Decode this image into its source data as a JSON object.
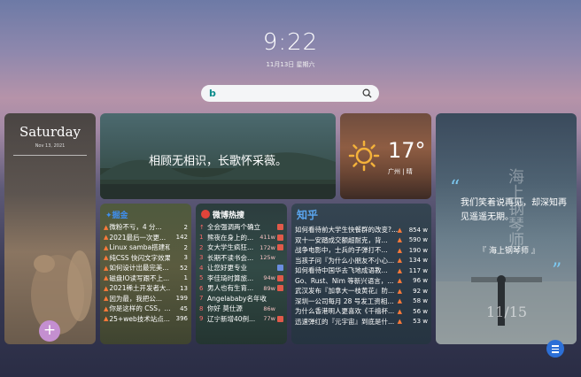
{
  "clock": {
    "time": "9:22",
    "date": "11月13日 星期六"
  },
  "search": {
    "engine_icon": "bing-icon",
    "placeholder": ""
  },
  "saturday_card": {
    "day": "Saturday",
    "date": "Nov 13, 2021"
  },
  "quote_card": {
    "text": "相顾无相识，长歌怀采薇。"
  },
  "weather_card": {
    "temperature": "17°",
    "city": "广州 | 晴",
    "icon": "sun-icon"
  },
  "movie_card": {
    "quote": "我们笑着说再见，却深知再见遥遥无期。",
    "source": "『 海上钢琴师 』",
    "poster_title": "海上钢琴师",
    "poster_date": "11/15"
  },
  "juejin": {
    "title": "掘金",
    "items": [
      {
        "text": "微粉不亏，4 分...",
        "count": "2"
      },
      {
        "text": "2021最后一次更...",
        "count": "142"
      },
      {
        "text": "Linux samba搭建和...",
        "count": "2"
      },
      {
        "text": "纯CSS 快闪文字效果",
        "count": "3"
      },
      {
        "text": "如何设计出最完美...",
        "count": "52"
      },
      {
        "text": "磁盘IO读写跟不上...",
        "count": "1"
      },
      {
        "text": "2021稀土开发者大...",
        "count": "13"
      },
      {
        "text": "因为最，我把公...",
        "count": "199"
      },
      {
        "text": "你是这样的 CSS，...",
        "count": "45"
      },
      {
        "text": "25+web技术站点...",
        "count": "396"
      }
    ]
  },
  "weibo": {
    "title": "微博热搜",
    "items": [
      {
        "rank": "",
        "text": "全会强调两个确立",
        "hot": "",
        "badge": "#e05a4a"
      },
      {
        "rank": "1",
        "text": "熊夜在身上的...",
        "hot": "411w",
        "badge": "#e05a4a"
      },
      {
        "rank": "2",
        "text": "女大学生疯狂...",
        "hot": "172w",
        "badge": "#e05a4a"
      },
      {
        "rank": "3",
        "text": "长期不读书会...",
        "hot": "125w",
        "badge": ""
      },
      {
        "rank": "4",
        "text": "让您好更专业",
        "hot": "",
        "badge": "#6a8de0"
      },
      {
        "rank": "5",
        "text": "李佳琦时算旅...",
        "hot": "94w",
        "badge": "#e05a4a"
      },
      {
        "rank": "6",
        "text": "男人也有生育...",
        "hot": "89w",
        "badge": "#e05a4a"
      },
      {
        "rank": "7",
        "text": "Angelababy名年收",
        "hot": "",
        "badge": ""
      },
      {
        "rank": "8",
        "text": "你好 莫仕源",
        "hot": "86w",
        "badge": ""
      },
      {
        "rank": "9",
        "text": "辽宁新增40例...",
        "hot": "77w",
        "badge": "#e05a4a"
      }
    ]
  },
  "zhihu": {
    "title": "知乎",
    "items": [
      {
        "text": "如何看待前大学生快餐群的改变?...",
        "hot": "854 w"
      },
      {
        "text": "双十一安踏成交额超耐克，背...",
        "hot": "590 w"
      },
      {
        "text": "战争电影中，士兵的子弹打不...",
        "hot": "190 w"
      },
      {
        "text": "当孩子问『为什么小朋友不小心...",
        "hot": "134 w"
      },
      {
        "text": "如何看待中国华去飞地成语教...",
        "hot": "117 w"
      },
      {
        "text": "Go、Rust、Nim 等新兴语言，...",
        "hot": "96 w"
      },
      {
        "text": "武汉发布『加拿大一枝黄花』防...",
        "hot": "92 w"
      },
      {
        "text": "深圳一公司每月 28 号发工资相...",
        "hot": "58 w"
      },
      {
        "text": "为什么香港明人更喜欢《千禧杯...",
        "hot": "56 w"
      },
      {
        "text": "迅速弹红的『元宇宙』到底是什...",
        "hot": "53 w"
      }
    ]
  },
  "colors": {
    "accent": "#2c6fd6",
    "plus": "#c48fd0",
    "zhihu_title": "#5aa6f0"
  }
}
